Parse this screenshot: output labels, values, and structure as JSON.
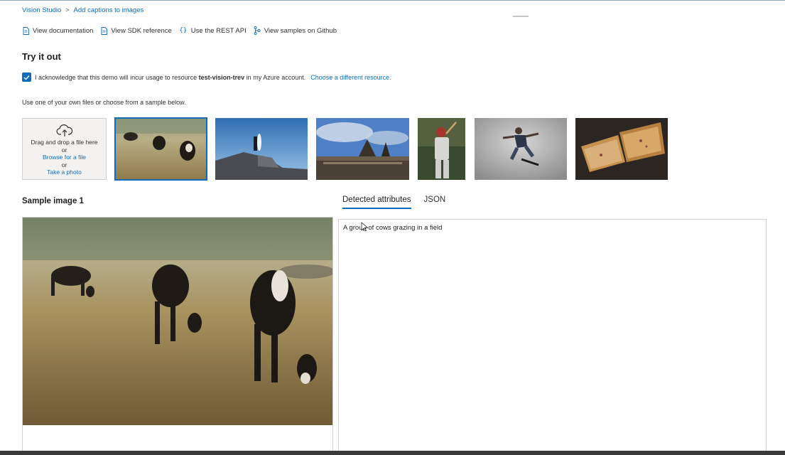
{
  "breadcrumb": {
    "root": "Vision Studio",
    "separator": ">",
    "current": "Add captions to images"
  },
  "doc_links": [
    {
      "label": "View documentation",
      "icon": "document-icon"
    },
    {
      "label": "View SDK reference",
      "icon": "document-icon"
    },
    {
      "label": "Use the REST API",
      "icon": "braces-icon"
    },
    {
      "label": "View samples on Github",
      "icon": "github-branch-icon"
    }
  ],
  "section_title": "Try it out",
  "acknowledge": {
    "checked": true,
    "text_before": "I acknowledge that this demo will incur usage to resource",
    "resource": "test-vision-trev",
    "text_after": "in my Azure account.",
    "link": "Choose a different resource."
  },
  "instruction": "Use one of your own files or choose from a sample below.",
  "upload": {
    "drag_text": "Drag and drop a file here",
    "or1": "or",
    "browse": "Browse for a file",
    "or2": "or",
    "photo": "Take a photo",
    "icon": "cloud-upload-icon"
  },
  "samples": [
    {
      "name": "cows",
      "selected": true
    },
    {
      "name": "surfer"
    },
    {
      "name": "building-statues"
    },
    {
      "name": "baseball-batter"
    },
    {
      "name": "skateboarder"
    },
    {
      "name": "sandwich"
    }
  ],
  "sample_title": "Sample image 1",
  "tabs": [
    {
      "label": "Detected attributes",
      "active": true
    },
    {
      "label": "JSON",
      "active": false
    }
  ],
  "result_caption": "A group of cows grazing in a field",
  "colors": {
    "accent": "#0f6cbd",
    "text": "#323130",
    "border": "#d2d0ce"
  }
}
